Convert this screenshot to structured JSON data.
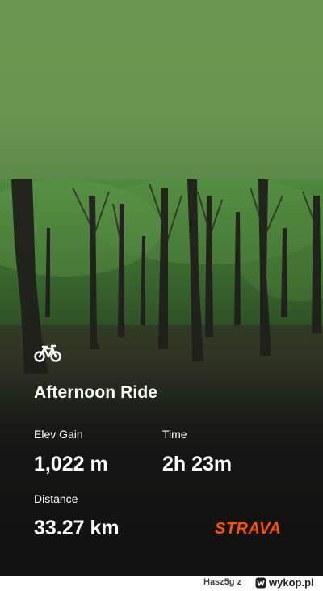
{
  "activity": {
    "icon": "bicycle-icon",
    "title": "Afternoon Ride"
  },
  "stats": {
    "elev_gain_label": "Elev Gain",
    "elev_gain_value": "1,022 m",
    "time_label": "Time",
    "time_value": "2h 23m",
    "distance_label": "Distance",
    "distance_value": "33.27 km"
  },
  "brand": {
    "logo_text": "STRAVA",
    "color": "#fc5200"
  },
  "footer": {
    "author": "Hasz5g",
    "separator": "z",
    "icon": "wykop-logo-icon",
    "site": "wykop.pl"
  },
  "colors": {
    "sky": "#6a9550",
    "overlay_dark": "#121212",
    "text": "#ffffff"
  }
}
